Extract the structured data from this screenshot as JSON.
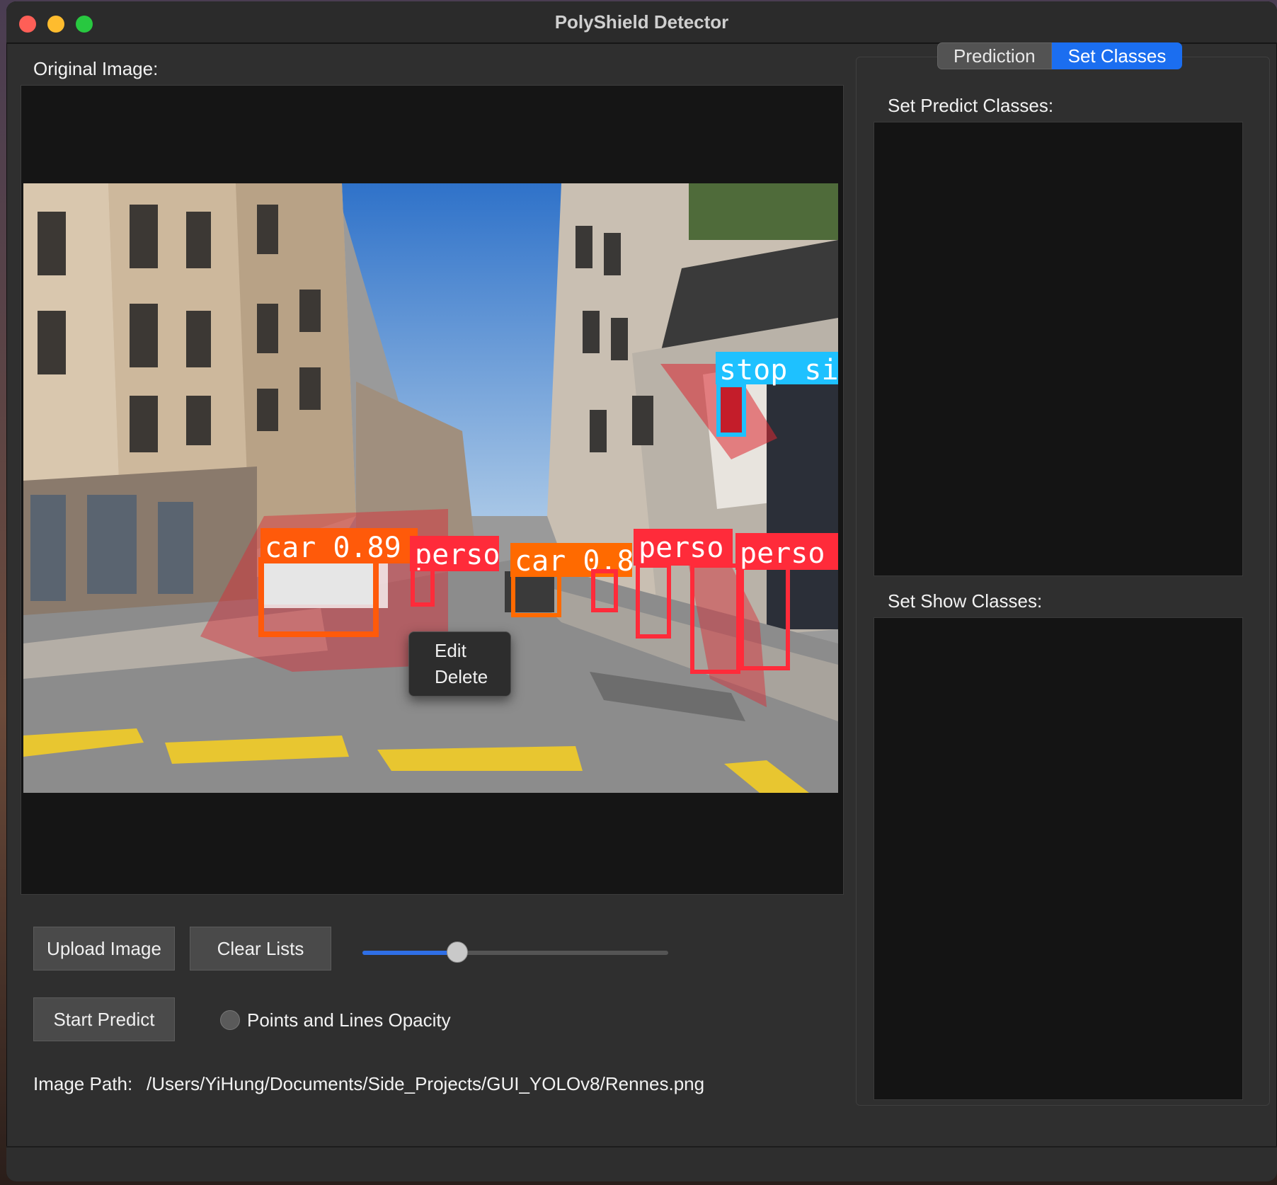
{
  "window": {
    "title": "PolyShield Detector"
  },
  "left": {
    "original_image_label": "Original Image:",
    "detections": [
      {
        "label": "car 0.89",
        "color": "#ff5a0a"
      },
      {
        "label": "perso",
        "color": "#ff2b3a"
      },
      {
        "label": "car 0.8",
        "color": "#ff6a00"
      },
      {
        "label": "perso",
        "color": "#ff2b3a"
      },
      {
        "label": "perso",
        "color": "#ff2b3a"
      },
      {
        "label": "stop si",
        "color": "#1ec1ff"
      }
    ],
    "context_menu": {
      "edit": "Edit",
      "delete": "Delete"
    },
    "buttons": {
      "upload": "Upload Image",
      "clear": "Clear Lists",
      "predict": "Start Predict"
    },
    "opacity_slider": {
      "value_fraction": 0.31
    },
    "opacity_radio_label": "Points and Lines Opacity",
    "image_path_label": "Image Path:",
    "image_path": "/Users/YiHung/Documents/Side_Projects/GUI_YOLOv8/Rennes.png"
  },
  "right": {
    "tabs": [
      {
        "label": "Prediction",
        "active": false
      },
      {
        "label": "Set Classes",
        "active": true
      }
    ],
    "predict_classes_label": "Set Predict Classes:",
    "show_classes_label": "Set Show Classes:"
  },
  "colors": {
    "accent": "#1b6ef0"
  }
}
